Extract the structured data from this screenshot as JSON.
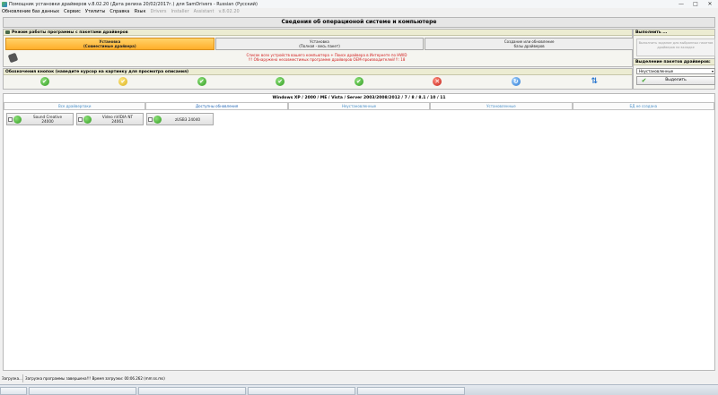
{
  "window": {
    "title": "Помощник установки драйверов v.8.02.20 (Дата релиза 20/02/2017г.) для SamDrivers - Russian (Русский)",
    "controls": [
      "—",
      "□",
      "✕"
    ]
  },
  "menu": [
    {
      "label": "Обновление баз данных",
      "enabled": true
    },
    {
      "label": "Сервис",
      "enabled": true
    },
    {
      "label": "Утилиты",
      "enabled": true
    },
    {
      "label": "Справка",
      "enabled": true
    },
    {
      "label": "Язык",
      "enabled": true
    },
    {
      "label": "Drivers",
      "enabled": false
    },
    {
      "label": "Installer",
      "enabled": false
    },
    {
      "label": "Assistant",
      "enabled": false
    },
    {
      "label": "v.8.02.20",
      "enabled": false
    }
  ],
  "header": {
    "title": "Сведения об операционой системе и компьютере"
  },
  "mode_panel": {
    "title": "Режим работы программы с пакетами драйверов",
    "buttons": [
      {
        "line1": "Установка",
        "line2": "(Совместимые драйвера)",
        "active": true
      },
      {
        "line1": "Установка",
        "line2": "(Полная - весь пакет)",
        "active": false
      },
      {
        "line1": "Создание или обновление",
        "line2": "базы драйверов",
        "active": false
      }
    ],
    "info_line1": "Список всех устройств вашего компьютера + Поиск драйвера в Интернете по HWID",
    "info_line2": "!!! Обнаружено несовместимых программе драйверов OEM-производителей!!!: 18"
  },
  "legend_panel": {
    "title": "Обозначения кнопок (наведите курсор на картинку для просмотра описания)",
    "icons": [
      {
        "name": "ok-green-icon",
        "color": "green",
        "glyph": "✔"
      },
      {
        "name": "ok-yellow-icon",
        "color": "yellow",
        "glyph": "✔"
      },
      {
        "name": "ok-green-warn-icon",
        "color": "green",
        "glyph": "✔"
      },
      {
        "name": "ok-green-down-icon",
        "color": "green",
        "glyph": "✔"
      },
      {
        "name": "ok-green-plus-icon",
        "color": "green",
        "glyph": "✔"
      },
      {
        "name": "error-red-icon",
        "color": "red",
        "glyph": "✕"
      },
      {
        "name": "refresh-blue-icon",
        "color": "blue",
        "glyph": "↻"
      },
      {
        "name": "swap-arrows-icon",
        "color": "arrow",
        "glyph": "⇅"
      }
    ]
  },
  "execute_panel": {
    "title": "Выполнить ...",
    "button_label": "Выполнить задание для выбранных пакетов драйверов на вкладке"
  },
  "selection_panel": {
    "title": "Выделение пакетов драйверов:",
    "selected_option": "Неустановленные",
    "button_label": "Выделить"
  },
  "main": {
    "os_title": "Windows XP / 2000 / ME / Vista / Server 2003/2008/2012 / 7 / 8 / 8.1 / 10 / 11",
    "tabs": [
      {
        "label": "Все драйверпаки",
        "active": false
      },
      {
        "label": "Доступны обновления",
        "active": true
      },
      {
        "label": "Неустановленные",
        "active": false
      },
      {
        "label": "Установленные",
        "active": false
      },
      {
        "label": "БД не создана",
        "active": false
      }
    ],
    "drivers": [
      {
        "line1": "Sound Creative",
        "line2": "24000"
      },
      {
        "line1": "Video nVIDIA NT",
        "line2": "24061"
      },
      {
        "line1": "zUSB3 24040",
        "line2": ""
      }
    ]
  },
  "status": {
    "left": "Загрузка...",
    "right": "Загрузка программы завершена!!! Время загрузки: 00:06.262 (mm:ss.ms)"
  }
}
